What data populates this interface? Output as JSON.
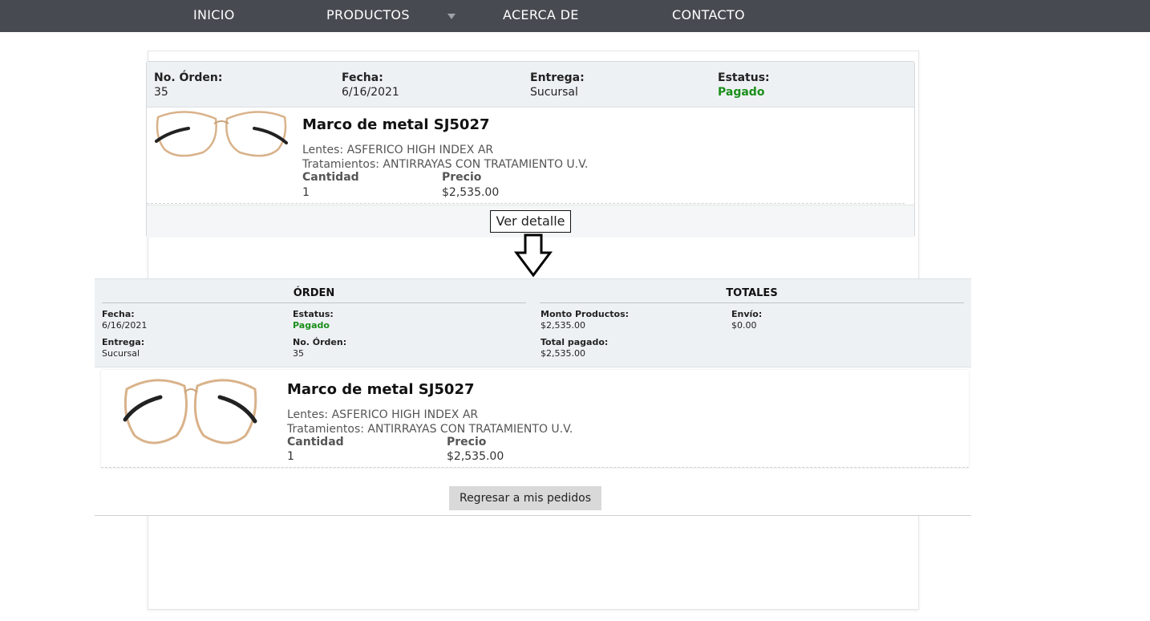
{
  "nav": {
    "items": [
      {
        "label": "INICIO"
      },
      {
        "label": "PRODUCTOS"
      },
      {
        "label": "ACERCA DE"
      },
      {
        "label": "CONTACTO"
      }
    ]
  },
  "summary": {
    "order_no_label": "No. Órden:",
    "order_no": "35",
    "date_label": "Fecha:",
    "date": "6/16/2021",
    "delivery_label": "Entrega:",
    "delivery": "Sucursal",
    "status_label": "Estatus:",
    "status": "Pagado",
    "product": {
      "title": "Marco de metal SJ5027",
      "lenses": "Lentes: ASFERICO HIGH INDEX AR",
      "treatments": "Tratamientos: ANTIRRAYAS CON TRATAMIENTO U.V.",
      "qty_label": "Cantidad",
      "qty": "1",
      "price_label": "Precio",
      "price": "$2,535.00"
    },
    "detail_button": "Ver detalle"
  },
  "detail": {
    "order_title": "ÓRDEN",
    "totals_title": "TOTALES",
    "date_label": "Fecha:",
    "date": "6/16/2021",
    "status_label": "Estatus:",
    "status": "Pagado",
    "delivery_label": "Entrega:",
    "delivery": "Sucursal",
    "order_no_label": "No. Órden:",
    "order_no": "35",
    "products_amount_label": "Monto Productos:",
    "products_amount": "$2,535.00",
    "shipping_label": "Envío:",
    "shipping": "$0.00",
    "total_paid_label": "Total pagado:",
    "total_paid": "$2,535.00",
    "product": {
      "title": "Marco de metal SJ5027",
      "lenses": "Lentes: ASFERICO HIGH INDEX AR",
      "treatments": "Tratamientos: ANTIRRAYAS CON TRATAMIENTO U.V.",
      "qty_label": "Cantidad",
      "qty": "1",
      "price_label": "Precio",
      "price": "$2,535.00"
    },
    "back_button": "Regresar a mis pedidos"
  },
  "colors": {
    "nav_bg": "#474a51",
    "header_bg": "#eef1f4",
    "status_green": "#1a8f1a",
    "back_button_bg": "#d9d9d9"
  },
  "icons": {
    "dropdown": "caret-down-icon",
    "arrow": "down-arrow-icon",
    "product": "glasses-image"
  }
}
